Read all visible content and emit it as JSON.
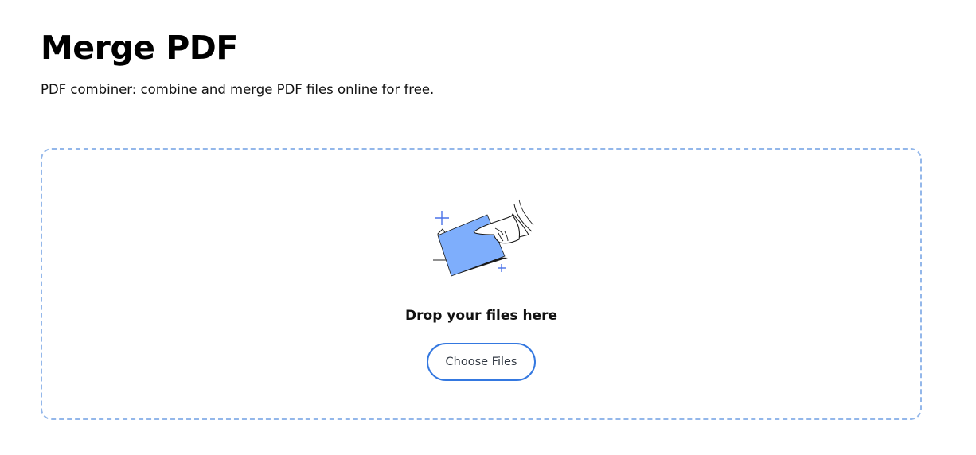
{
  "header": {
    "title": "Merge PDF",
    "subtitle": "PDF combiner: combine and merge PDF files online for free."
  },
  "upload": {
    "illustration_icon": "hand-dropping-file-icon",
    "drop_text": "Drop your files here",
    "choose_button_label": "Choose Files"
  },
  "colors": {
    "accent": "#3478e0",
    "dropzone_border": "#93b7ea",
    "file_fill": "#7eaefc",
    "sparkle": "#4a72e8"
  }
}
